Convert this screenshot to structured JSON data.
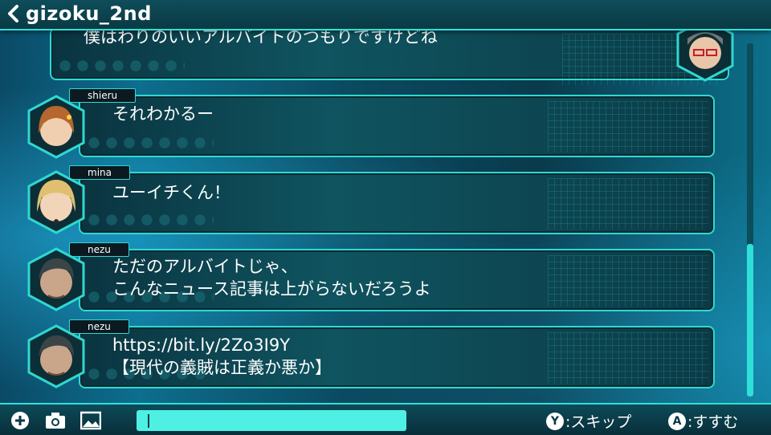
{
  "header": {
    "title": "gizoku_2nd"
  },
  "messages": [
    {
      "user": "",
      "text": "僕はわりのいいアルバイトのつもりですけどね",
      "avatar": "yuichi-avatar"
    },
    {
      "user": "shieru",
      "text": "それわかるー",
      "avatar": "shieru-avatar"
    },
    {
      "user": "mina",
      "text": "ユーイチくん！",
      "avatar": "mina-avatar"
    },
    {
      "user": "nezu",
      "text": "ただのアルバイトじゃ、\nこんなニュース記事は上がらないだろうよ",
      "avatar": "nezu-avatar"
    },
    {
      "user": "nezu",
      "text": "https://bit.ly/2Zo3I9Y\n【現代の義賊は正義か悪か】",
      "avatar": "nezu-avatar"
    }
  ],
  "footer": {
    "skip_button": "Y",
    "skip_label": ":スキップ",
    "advance_button": "A",
    "advance_label": ":すすむ"
  },
  "colors": {
    "accent": "#2fe0d8",
    "input": "#4ef0e4"
  }
}
